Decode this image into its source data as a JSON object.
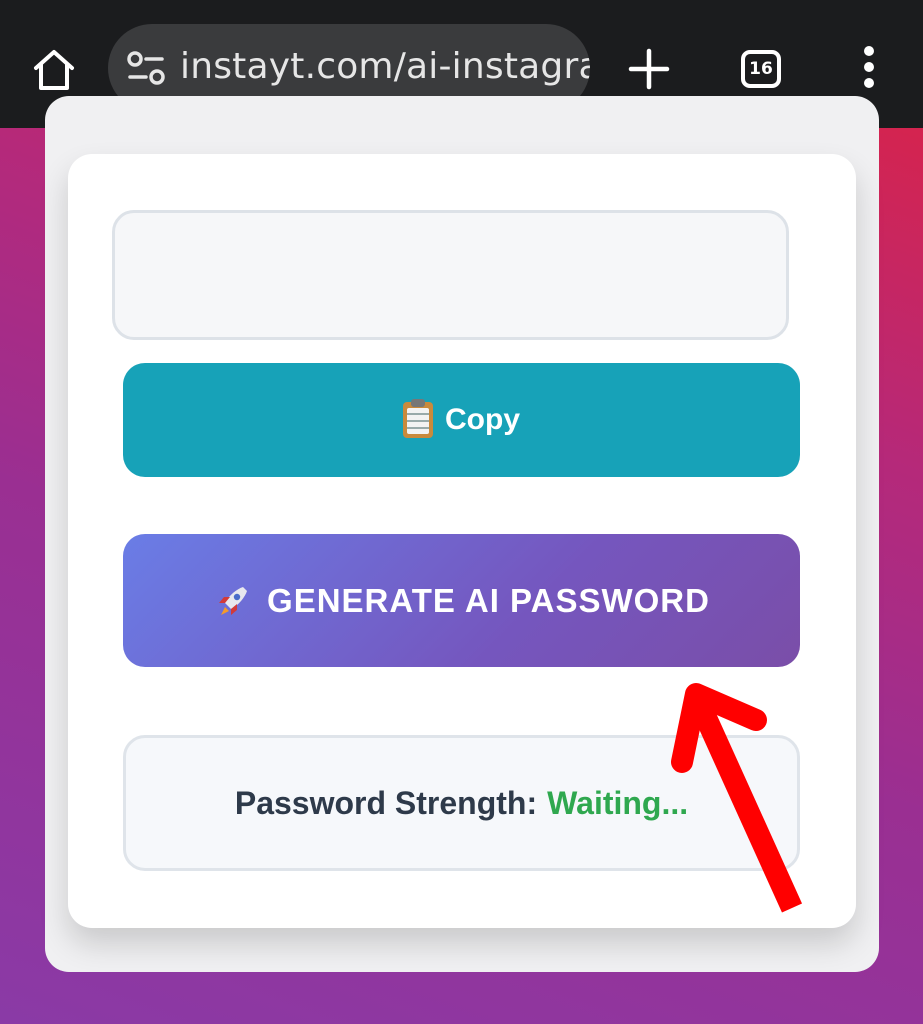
{
  "browser": {
    "url": "instayt.com/ai-instagra",
    "tab_count": "16",
    "icons": [
      "home-icon",
      "site-settings-icon",
      "plus-icon",
      "tab-switcher-icon",
      "more-vert-icon"
    ]
  },
  "generator": {
    "password_value": "",
    "copy_label": "Copy",
    "copy_icon": "clipboard-icon",
    "generate_label": "GENERATE AI PASSWORD",
    "generate_icon": "rocket-icon",
    "strength_label": "Password Strength:",
    "strength_value": "Waiting..."
  },
  "colors": {
    "copy_button": "#17a2b8",
    "generate_gradient_start": "#6a7de6",
    "generate_gradient_end": "#7a4ea8",
    "strength_value": "#2fa84f",
    "annotation_arrow": "#ff0000"
  }
}
